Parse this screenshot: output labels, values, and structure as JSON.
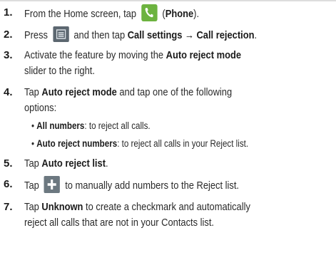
{
  "steps": [
    {
      "number": "1.",
      "pre": "From the Home screen, tap ",
      "icon": "phone-icon",
      "post1": " (",
      "bold1": "Phone",
      "post2": ")."
    },
    {
      "number": "2.",
      "pre": "Press ",
      "icon": "menu-icon",
      "mid": " and then tap ",
      "bold1": "Call settings → Call rejection",
      "post": "."
    },
    {
      "number": "3.",
      "line1_pre": "Activate the feature by moving the ",
      "bold1": "Auto reject mode",
      "line2": "slider to the right."
    },
    {
      "number": "4.",
      "line1_pre": "Tap ",
      "bold1": "Auto reject mode",
      "line1_post": " and tap one of the following",
      "line2": "options:"
    },
    {
      "number": "5.",
      "pre": "Tap ",
      "bold1": "Auto reject list",
      "post": "."
    },
    {
      "number": "6.",
      "pre": "Tap ",
      "icon": "plus-icon",
      "post": " to manually add numbers to the Reject list."
    },
    {
      "number": "7.",
      "line1_pre": "Tap ",
      "bold1": "Unknown",
      "line1_post": " to create a checkmark and automatically",
      "line2": "reject all calls that are not in your Contacts list."
    }
  ],
  "bullets": [
    {
      "bold": "All numbers",
      "rest": ": to reject all calls."
    },
    {
      "bold": "Auto reject numbers",
      "rest": ": to reject all calls in your Reject list."
    }
  ],
  "icons": {
    "phone_bg": "#6cb33f",
    "menu_bg": "#5c6770",
    "plus_bg": "#6c7880"
  }
}
